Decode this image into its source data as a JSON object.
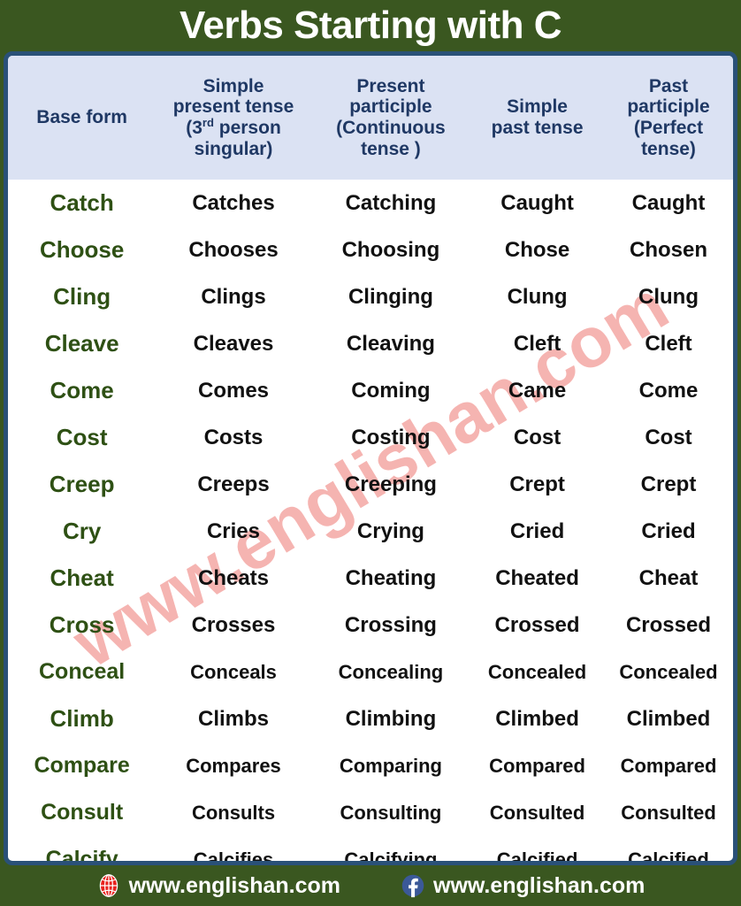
{
  "page": {
    "title": "Verbs Starting with C",
    "background_color": "#3a5720",
    "border_color": "#2a5178",
    "header_bg_color": "#dbe2f3",
    "header_text_color": "#1f3864",
    "base_form_color": "#2e5014",
    "body_text_color": "#111111",
    "watermark_color": "#f4a7a4"
  },
  "watermark": {
    "text": "www.englishan.com"
  },
  "table": {
    "headers": [
      {
        "line1": "Base form",
        "line2": "",
        "line3": "",
        "line4": ""
      },
      {
        "line1": "Simple",
        "line2": "present tense",
        "line3": "(3rd person",
        "line4": "singular)"
      },
      {
        "line1": "Present",
        "line2": "participle",
        "line3": "(Continuous",
        "line4": "tense )"
      },
      {
        "line1": "Simple",
        "line2": "past tense",
        "line3": "",
        "line4": ""
      },
      {
        "line1": "Past",
        "line2": "participle",
        "line3": "(Perfect",
        "line4": "tense)"
      }
    ],
    "header_labels": [
      "Base form",
      "Simple present tense (3rd person singular)",
      "Present participle (Continuous tense )",
      "Simple past tense",
      "Past participle (Perfect tense)"
    ],
    "rows": [
      {
        "base": "Catch",
        "simple_present": "Catches",
        "present_participle": "Catching",
        "simple_past": "Caught",
        "past_participle": "Caught"
      },
      {
        "base": "Choose",
        "simple_present": "Chooses",
        "present_participle": "Choosing",
        "simple_past": "Chose",
        "past_participle": "Chosen"
      },
      {
        "base": "Cling",
        "simple_present": "Clings",
        "present_participle": "Clinging",
        "simple_past": "Clung",
        "past_participle": "Clung"
      },
      {
        "base": "Cleave",
        "simple_present": "Cleaves",
        "present_participle": "Cleaving",
        "simple_past": "Cleft",
        "past_participle": "Cleft"
      },
      {
        "base": "Come",
        "simple_present": "Comes",
        "present_participle": "Coming",
        "simple_past": "Came",
        "past_participle": "Come"
      },
      {
        "base": "Cost",
        "simple_present": "Costs",
        "present_participle": "Costing",
        "simple_past": "Cost",
        "past_participle": "Cost"
      },
      {
        "base": "Creep",
        "simple_present": "Creeps",
        "present_participle": "Creeping",
        "simple_past": "Crept",
        "past_participle": "Crept"
      },
      {
        "base": "Cry",
        "simple_present": "Cries",
        "present_participle": "Crying",
        "simple_past": "Cried",
        "past_participle": "Cried"
      },
      {
        "base": "Cheat",
        "simple_present": "Cheats",
        "present_participle": "Cheating",
        "simple_past": "Cheated",
        "past_participle": "Cheat"
      },
      {
        "base": "Cross",
        "simple_present": "Crosses",
        "present_participle": "Crossing",
        "simple_past": "Crossed",
        "past_participle": "Crossed"
      },
      {
        "base": "Conceal",
        "simple_present": "Conceals",
        "present_participle": "Concealing",
        "simple_past": "Concealed",
        "past_participle": "Concealed"
      },
      {
        "base": "Climb",
        "simple_present": "Climbs",
        "present_participle": "Climbing",
        "simple_past": "Climbed",
        "past_participle": "Climbed"
      },
      {
        "base": "Compare",
        "simple_present": "Compares",
        "present_participle": "Comparing",
        "simple_past": "Compared",
        "past_participle": "Compared"
      },
      {
        "base": "Consult",
        "simple_present": "Consults",
        "present_participle": "Consulting",
        "simple_past": "Consulted",
        "past_participle": "Consulted"
      },
      {
        "base": "Calcify",
        "simple_present": "Calcifies",
        "present_participle": "Calcifying",
        "simple_past": "Calcified",
        "past_participle": "Calcified"
      }
    ]
  },
  "footer": {
    "items": [
      {
        "icon": "globe-icon",
        "label": "www.englishan.com"
      },
      {
        "icon": "facebook-icon",
        "label": "www.englishan.com"
      }
    ]
  }
}
